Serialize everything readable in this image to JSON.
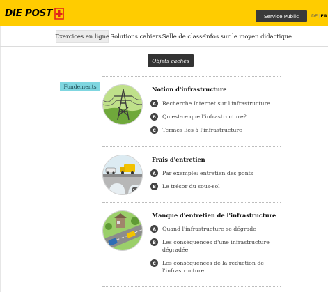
{
  "header": {
    "logo_text": "DIE POST",
    "service_button": "Service Public",
    "languages": [
      "DE",
      "FR"
    ],
    "active_language": "FR"
  },
  "nav": {
    "items": [
      {
        "label": "Exercices en ligne",
        "active": true
      },
      {
        "label": "Solutions cahiers",
        "active": false
      },
      {
        "label": "Salle de classe",
        "active": false
      },
      {
        "label": "Infos sur le moyen didactique",
        "active": false
      }
    ]
  },
  "hidden_objects_button": "Objets cachés",
  "category_tag": "Fondements",
  "sections": [
    {
      "title": "Notion d'infrastructure",
      "items": [
        {
          "badge": "A",
          "text": "Recherche Internet sur l'infrastructure"
        },
        {
          "badge": "B",
          "text": "Qu'est-ce que l'infrastructure?"
        },
        {
          "badge": "C",
          "text": "Termes liés à l'infrastructure"
        }
      ]
    },
    {
      "title": "Frais d'entretien",
      "items": [
        {
          "badge": "A",
          "text": "Par exemple: entretien des ponts"
        },
        {
          "badge": "B",
          "text": "Le trésor du sous-sol"
        }
      ]
    },
    {
      "title": "Manque d'entretien de l'infrastructure",
      "items": [
        {
          "badge": "A",
          "text": "Quand l'infrastructure se dégrade"
        },
        {
          "badge": "B",
          "text": "Les conséquences d'une infrastructure dégradée"
        },
        {
          "badge": "C",
          "text": "Les conséquences de la réduction de l'infrastructure"
        }
      ]
    }
  ],
  "colors": {
    "brand_yellow": "#ffcc00",
    "brand_red": "#e2231a",
    "tag_cyan": "#7fd6e0",
    "dark_button": "#333333"
  }
}
